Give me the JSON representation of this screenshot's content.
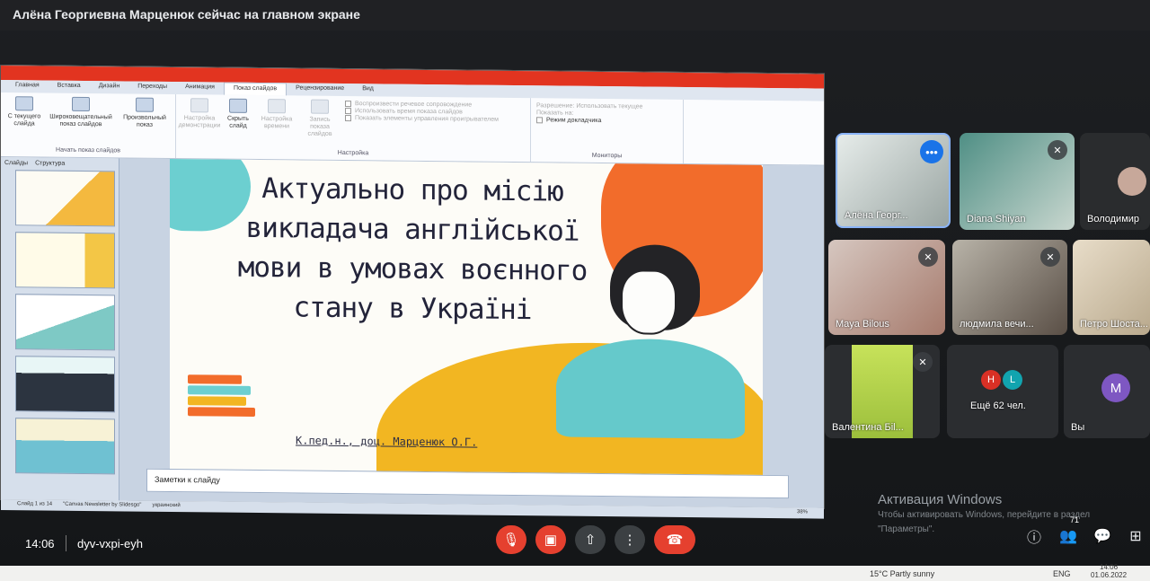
{
  "banner": "Алёна Георгиевна Марценюк сейчас на главном экране",
  "ppt": {
    "tabs": [
      "Главная",
      "Вставка",
      "Дизайн",
      "Переходы",
      "Анимация",
      "Показ слайдов",
      "Рецензирование",
      "Вид"
    ],
    "active_tab": "Показ слайдов",
    "ribbon": {
      "from_current": "С текущего слайда",
      "broadcast": "Широковещательный показ слайдов",
      "custom": "Произвольный показ",
      "group_start": "Начать показ слайдов",
      "setup": "Настройка демонстрации",
      "hide": "Скрыть слайд",
      "rehearse": "Настройка времени",
      "record": "Запись показа слайдов",
      "cb1": "Воспроизвести речевое сопровождение",
      "cb2": "Использовать время показа слайдов",
      "cb3": "Показать элементы управления проигрывателем",
      "group_setup": "Настройка",
      "resolution": "Разрешение: Использовать текущее",
      "show_on": "Показать на:",
      "presenter": "Режим докладчика",
      "group_monitors": "Мониторы"
    },
    "thumb_tabs": [
      "Слайды",
      "Структура"
    ],
    "slide": {
      "title_lines": [
        "Актуально про місію",
        "викладача англійської",
        "мови в умовах воєнного",
        "стану в Україні"
      ],
      "author": "К.пед.н., доц. Марценюк О.Г."
    },
    "notes": "Заметки к слайду",
    "status": [
      "Слайд 1 из 14",
      "\"Сanvas Newsletter by Slidesgo\"",
      "украинский"
    ],
    "zoom": "38%"
  },
  "participants": [
    {
      "name": "Алёна Георг...",
      "pinned": true
    },
    {
      "name": "Diana Shiyan",
      "muted": true
    },
    {
      "name": "Володимир",
      "avatar": true
    },
    {
      "name": "Maya Bilous",
      "muted": true
    },
    {
      "name": "людмила вечи...",
      "muted": true
    },
    {
      "name": "Петро Шоста..."
    },
    {
      "name": "Валентина Бil...",
      "muted": true
    },
    {
      "name": "Ещё 62 чел.",
      "initials": [
        "H",
        "L"
      ]
    },
    {
      "name": "Вы",
      "initial": "M"
    }
  ],
  "windows_activation": {
    "line1": "Активация Windows",
    "line2": "Чтобы активировать Windows, перейдите в раздел",
    "line3": "\"Параметры\"."
  },
  "meet": {
    "time": "14:06",
    "code": "dyv-vxpi-eyh",
    "people_count": "71"
  },
  "taskbar": {
    "weather": "15°C  Partly sunny",
    "lang": "ENG",
    "time": "14:06",
    "date": "01.06.2022"
  },
  "colors": {
    "end_call": "#e5402f",
    "pin": "#1a73e8"
  }
}
